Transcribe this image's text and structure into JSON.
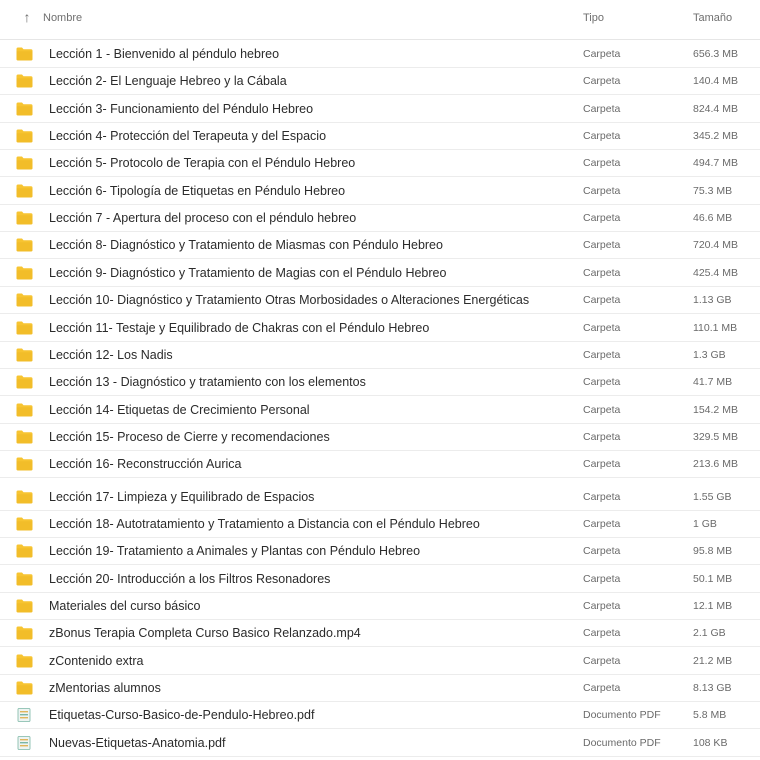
{
  "header": {
    "sort_icon": "arrow-up-icon",
    "name_label": "Nombre",
    "type_label": "Tipo",
    "size_label": "Tamaño"
  },
  "colors": {
    "folder": "#f7c431",
    "folder_shade": "#e9b11d",
    "pdf_icon": "#7bb6a5",
    "pdf_icon_alt": "#e0b55a"
  },
  "rows": [
    {
      "name": "Lección 1 - Bienvenido al péndulo hebreo",
      "type": "Carpeta",
      "size": "656.3 MB",
      "icon": "folder-icon"
    },
    {
      "name": "Lección 2- El Lenguaje Hebreo y la Cábala",
      "type": "Carpeta",
      "size": "140.4 MB",
      "icon": "folder-icon"
    },
    {
      "name": "Lección 3- Funcionamiento del Péndulo Hebreo",
      "type": "Carpeta",
      "size": "824.4 MB",
      "icon": "folder-icon"
    },
    {
      "name": "Lección 4- Protección del Terapeuta y del Espacio",
      "type": "Carpeta",
      "size": "345.2 MB",
      "icon": "folder-icon"
    },
    {
      "name": "Lección 5- Protocolo de Terapia con el Péndulo Hebreo",
      "type": "Carpeta",
      "size": "494.7 MB",
      "icon": "folder-icon"
    },
    {
      "name": "Lección 6- Tipología de Etiquetas en Péndulo Hebreo",
      "type": "Carpeta",
      "size": "75.3 MB",
      "icon": "folder-icon"
    },
    {
      "name": "Lección 7 - Apertura del proceso con el péndulo hebreo",
      "type": "Carpeta",
      "size": "46.6 MB",
      "icon": "folder-icon"
    },
    {
      "name": "Lección 8- Diagnóstico y Tratamiento de Miasmas con Péndulo Hebreo",
      "type": "Carpeta",
      "size": "720.4 MB",
      "icon": "folder-icon"
    },
    {
      "name": "Lección 9- Diagnóstico y Tratamiento de Magias con el Péndulo Hebreo",
      "type": "Carpeta",
      "size": "425.4 MB",
      "icon": "folder-icon"
    },
    {
      "name": "Lección 10- Diagnóstico y Tratamiento Otras Morbosidades o Alteraciones Energéticas",
      "type": "Carpeta",
      "size": "1.13 GB",
      "icon": "folder-icon"
    },
    {
      "name": "Lección 11- Testaje y Equilibrado de Chakras con el Péndulo Hebreo",
      "type": "Carpeta",
      "size": "110.1 MB",
      "icon": "folder-icon"
    },
    {
      "name": "Lección 12- Los Nadis",
      "type": "Carpeta",
      "size": "1.3 GB",
      "icon": "folder-icon"
    },
    {
      "name": "Lección 13 - Diagnóstico y tratamiento con los elementos",
      "type": "Carpeta",
      "size": "41.7 MB",
      "icon": "folder-icon"
    },
    {
      "name": "Lección 14- Etiquetas de Crecimiento Personal",
      "type": "Carpeta",
      "size": "154.2 MB",
      "icon": "folder-icon"
    },
    {
      "name": "Lección 15- Proceso de Cierre y recomendaciones",
      "type": "Carpeta",
      "size": "329.5 MB",
      "icon": "folder-icon"
    },
    {
      "name": "Lección 16- Reconstrucción Aurica",
      "type": "Carpeta",
      "size": "213.6 MB",
      "icon": "folder-icon"
    },
    {
      "name": "Lección 17- Limpieza y Equilibrado de Espacios",
      "type": "Carpeta",
      "size": "1.55 GB",
      "icon": "folder-icon"
    },
    {
      "name": "Lección 18- Autotratamiento y Tratamiento a Distancia con el Péndulo Hebreo",
      "type": "Carpeta",
      "size": "1 GB",
      "icon": "folder-icon"
    },
    {
      "name": "Lección 19- Tratamiento a Animales y Plantas con Péndulo Hebreo",
      "type": "Carpeta",
      "size": "95.8 MB",
      "icon": "folder-icon"
    },
    {
      "name": "Lección 20- Introducción a los Filtros Resonadores",
      "type": "Carpeta",
      "size": "50.1 MB",
      "icon": "folder-icon"
    },
    {
      "name": "Materiales del curso básico",
      "type": "Carpeta",
      "size": "12.1 MB",
      "icon": "folder-icon"
    },
    {
      "name": "zBonus Terapia Completa Curso Basico Relanzado.mp4",
      "type": "Carpeta",
      "size": "2.1 GB",
      "icon": "folder-icon"
    },
    {
      "name": "zContenido extra",
      "type": "Carpeta",
      "size": "21.2 MB",
      "icon": "folder-icon"
    },
    {
      "name": "zMentorias alumnos",
      "type": "Carpeta",
      "size": "8.13 GB",
      "icon": "folder-icon"
    },
    {
      "name": "Etiquetas-Curso-Basico-de-Pendulo-Hebreo.pdf",
      "type": "Documento PDF",
      "size": "5.8 MB",
      "icon": "pdf-document-icon"
    },
    {
      "name": "Nuevas-Etiquetas-Anatomia.pdf",
      "type": "Documento PDF",
      "size": "108 KB",
      "icon": "pdf-document-icon"
    }
  ]
}
